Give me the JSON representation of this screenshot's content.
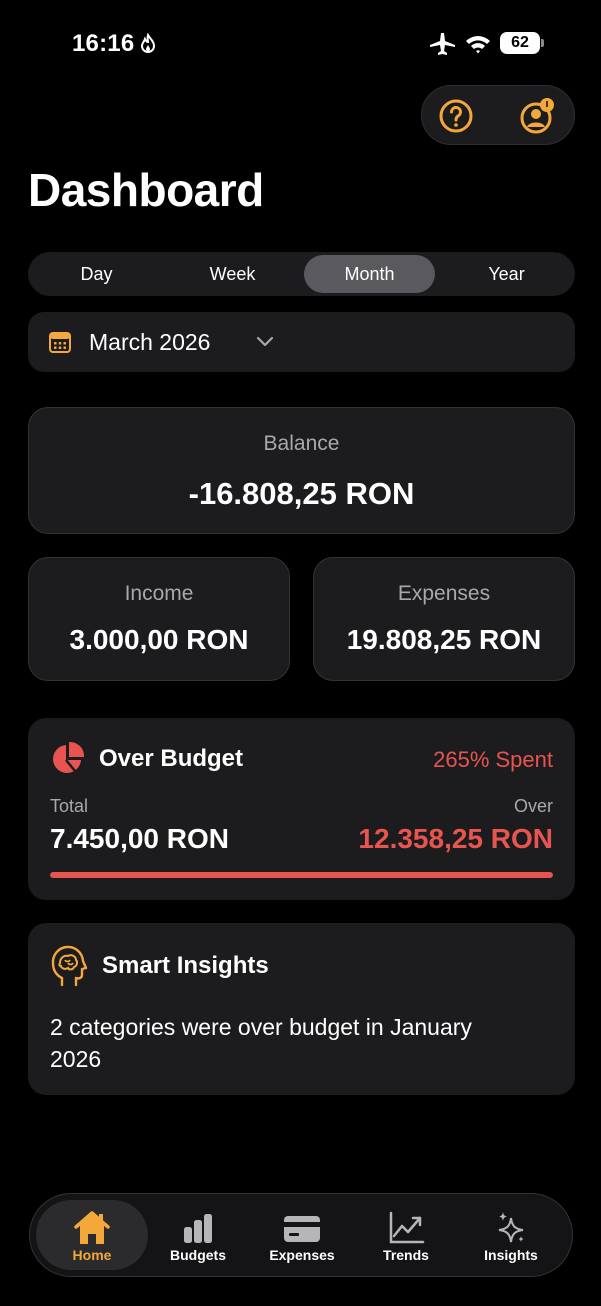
{
  "status_bar": {
    "time": "16:16",
    "battery": "62"
  },
  "page": {
    "title": "Dashboard"
  },
  "periods": {
    "selected": "Month",
    "options": [
      "Day",
      "Week",
      "Month",
      "Year"
    ]
  },
  "date_picker": {
    "label": "March 2026"
  },
  "balance": {
    "label": "Balance",
    "value": "-16.808,25 RON"
  },
  "income": {
    "label": "Income",
    "value": "3.000,00 RON"
  },
  "expenses": {
    "label": "Expenses",
    "value": "19.808,25 RON"
  },
  "budget": {
    "title": "Over Budget",
    "spent": "265% Spent",
    "total_label": "Total",
    "total_value": "7.450,00 RON",
    "over_label": "Over",
    "over_value": "12.358,25 RON",
    "progress_fraction": 1.0
  },
  "insights": {
    "title": "Smart Insights",
    "text": "2 categories were over budget in January 2026"
  },
  "tabs": [
    {
      "label": "Home",
      "icon": "home-icon"
    },
    {
      "label": "Budgets",
      "icon": "bar-chart-icon"
    },
    {
      "label": "Expenses",
      "icon": "credit-card-icon"
    },
    {
      "label": "Trends",
      "icon": "trend-line-icon"
    },
    {
      "label": "Insights",
      "icon": "sparkles-icon"
    }
  ],
  "colors": {
    "accent": "#f5a83a",
    "danger": "#e8544f",
    "card": "#1c1c1e",
    "background": "#000000"
  }
}
